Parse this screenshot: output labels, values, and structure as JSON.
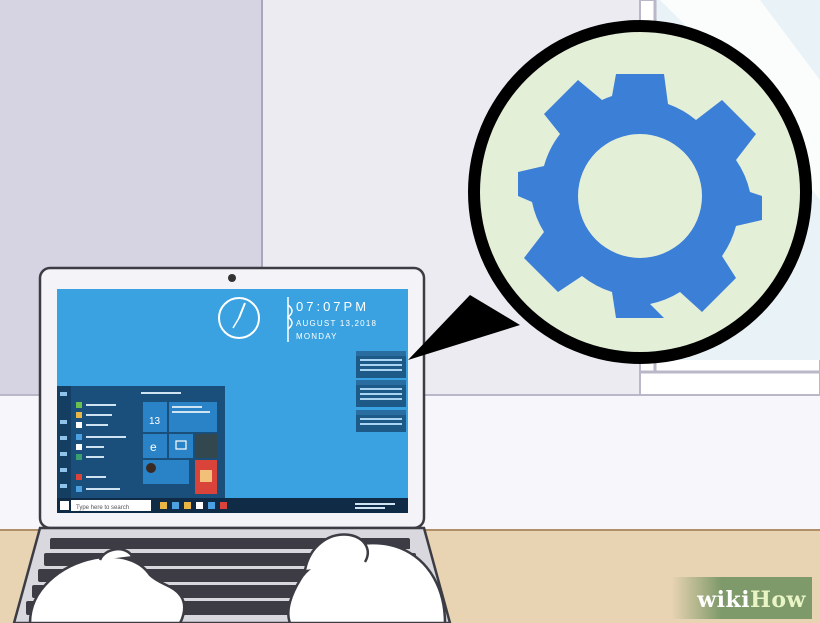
{
  "desktop": {
    "clock_time": "07:07PM",
    "clock_date": "AUGUST 13,2018",
    "clock_day": "MONDAY"
  },
  "start_menu": {
    "calendar_day": "13"
  },
  "taskbar": {
    "search_placeholder": "Type here to search"
  },
  "zoom_icon": "gear-icon",
  "colors": {
    "wall": "#d8d5e6",
    "screen": "#3aa2e0",
    "gear": "#3b7fd6",
    "zoom_bg": "#e4efd8",
    "desk": "#ead7b9"
  },
  "watermark": {
    "prefix": "wiki",
    "suffix": "How"
  }
}
